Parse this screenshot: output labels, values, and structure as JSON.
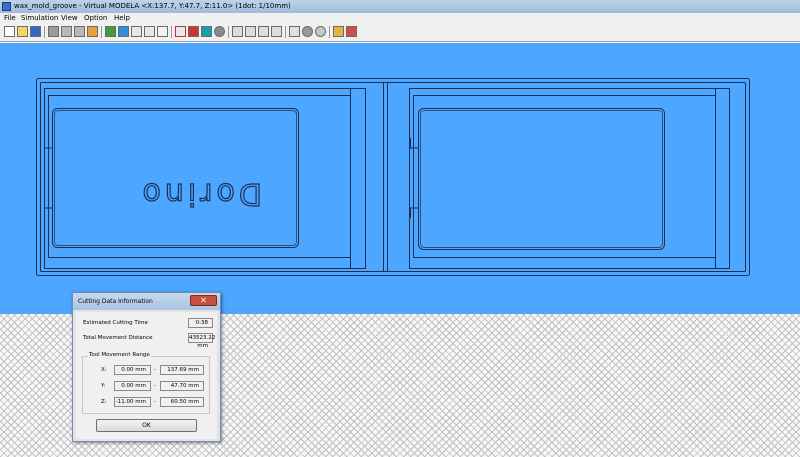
{
  "window": {
    "title": "wax_mold_groove - Virtual MODELA <X:137.7, Y:47.7, Z:11.0> (1dot: 1/10mm)"
  },
  "menu": {
    "file": "File",
    "simulation": "Simulation",
    "view": "View",
    "option": "Option",
    "help": "Help"
  },
  "toolbar": {
    "buttons": [
      "new-icon",
      "open-icon",
      "save-icon",
      "stop-icon",
      "play-icon",
      "step-icon",
      "settings-icon",
      "material-icon",
      "tool-icon",
      "path-icon",
      "curve-icon",
      "zoom-icon",
      "cut-view-icon",
      "color-icon",
      "render-icon",
      "shade-icon",
      "rotate-left-icon",
      "rotate-right-icon",
      "rotate-up-icon",
      "rotate-down-icon",
      "view-top-icon",
      "view-front-icon",
      "view-side-icon",
      "sphere-icon",
      "info-icon",
      "help-icon"
    ]
  },
  "workpiece": {
    "engraved_text": "Dorino",
    "engraving_mirrored": true
  },
  "colors": {
    "viewport": "#4da6ff",
    "dialog_close": "#c7503e"
  },
  "dialog": {
    "title": "Cutting Data Information",
    "close_symbol": "✕",
    "cutting_time_label": "Estimated Cutting Time",
    "cutting_time_value": "0:38",
    "movement_label": "Total Movement Distance",
    "movement_value": "43523.22 mm",
    "range_title": "Tool Movement Range",
    "range_rows": [
      {
        "axis": "X:",
        "min": "0.00 mm",
        "max": "137.69 mm"
      },
      {
        "axis": "Y:",
        "min": "0.00 mm",
        "max": "47.70 mm"
      },
      {
        "axis": "Z:",
        "min": "-11.00 mm",
        "max": "60.50 mm"
      }
    ],
    "range_separator": "-",
    "ok_label": "OK"
  }
}
